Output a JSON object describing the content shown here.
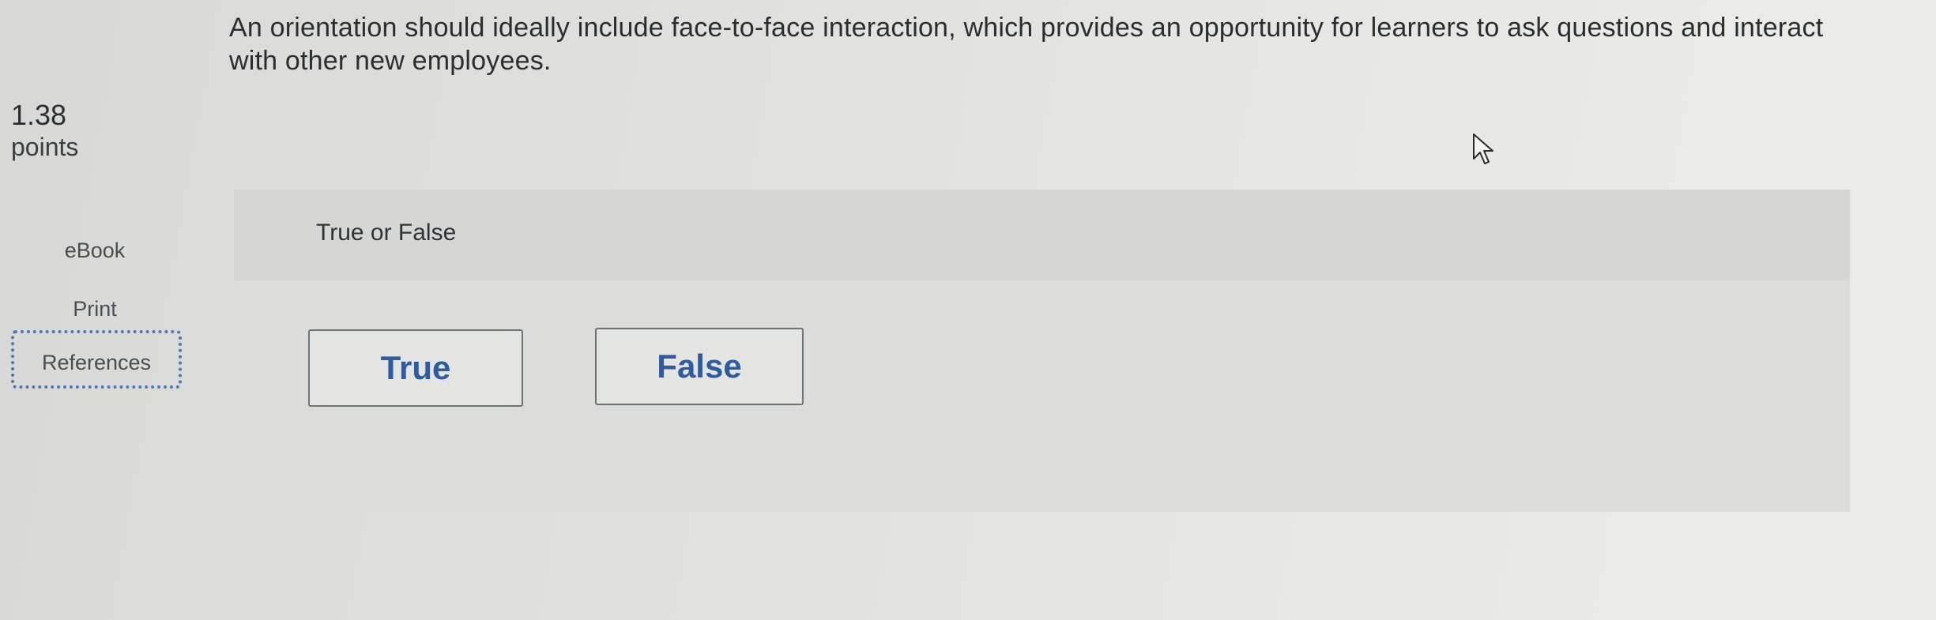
{
  "question": {
    "text": "An orientation should ideally include face-to-face interaction, which provides an opportunity for learners to ask questions and interact with other new employees."
  },
  "score": {
    "value": "1.38",
    "unit": "points"
  },
  "side_links": {
    "ebook": "eBook",
    "print": "Print",
    "references": "References"
  },
  "panel": {
    "title": "True or False",
    "options": [
      "True",
      "False"
    ]
  },
  "colors": {
    "accent": "#2e5c9e",
    "focus_outline": "#4b78b8"
  },
  "icons": {
    "cursor": "mouse-pointer-icon"
  }
}
